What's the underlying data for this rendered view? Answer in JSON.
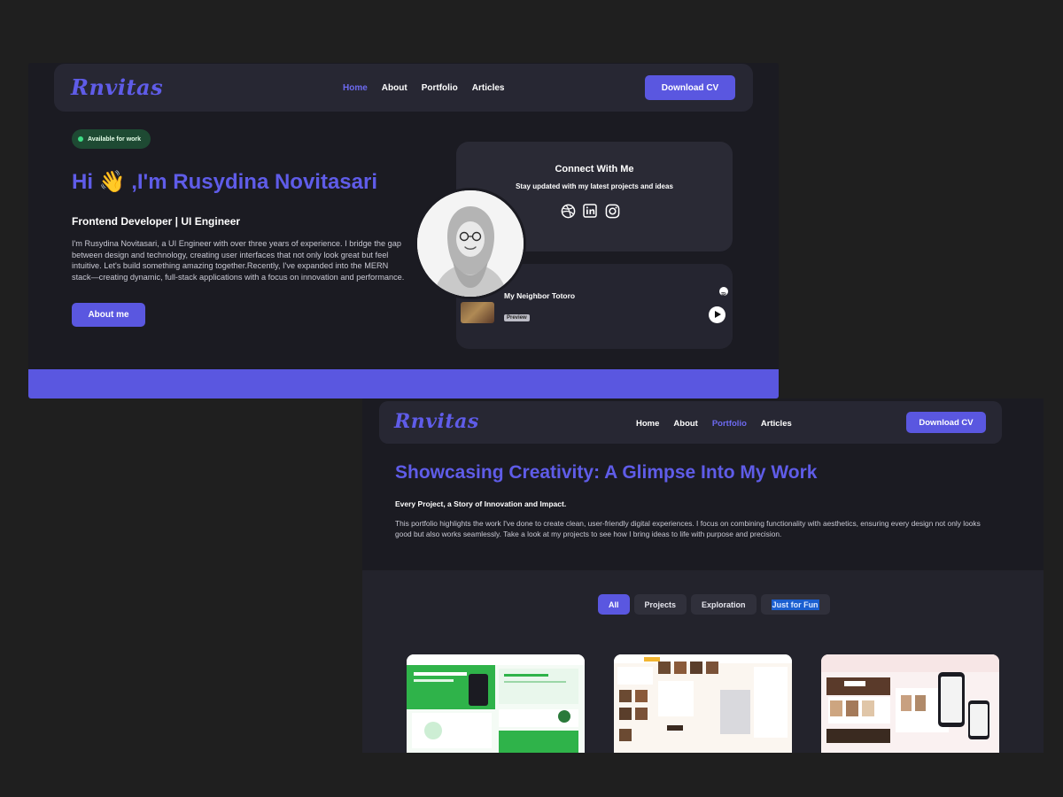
{
  "screen1": {
    "nav": {
      "logo": "Rnvitas",
      "links": [
        "Home",
        "About",
        "Portfolio",
        "Articles"
      ],
      "active": "Home",
      "cta": "Download CV"
    },
    "badge": "Available for work",
    "greeting": "Hi 👋 ,I'm Rusydina Novitasari",
    "role": "Frontend Developer | UI Engineer",
    "bio": "I'm Rusydina Novitasari, a UI Engineer with over three years of experience. I bridge the gap between design and technology, creating user interfaces that not only look great but feel intuitive. Let's build something amazing together.Recently, I've expanded into the MERN stack—creating dynamic, full-stack applications with a focus on innovation and performance.",
    "about_button": "About me",
    "connect": {
      "title": "Connect With Me",
      "subtitle": "Stay updated with my latest projects and ideas",
      "icons": [
        "dribbble-icon",
        "linkedin-icon",
        "instagram-icon"
      ]
    },
    "music": {
      "title": "My Neighbor Totoro",
      "tag": "Preview"
    }
  },
  "screen2": {
    "nav": {
      "logo": "Rnvitas",
      "links": [
        "Home",
        "About",
        "Portfolio",
        "Articles"
      ],
      "active": "Portfolio",
      "cta": "Download CV"
    },
    "heading": "Showcasing Creativity: A Glimpse Into My Work",
    "subheading": "Every Project, a Story of Innovation and Impact.",
    "description": "This portfolio highlights the work I've done to create clean, user-friendly digital experiences. I focus on combining functionality with aesthetics, ensuring every design not only looks good but also works seamlessly. Take a look at my projects to see how I bring ideas to life with purpose and precision.",
    "filters": [
      "All",
      "Projects",
      "Exploration",
      "Just for Fun"
    ],
    "active_filter": "All"
  },
  "colors": {
    "accent": "#5a57e0",
    "heading": "#5f5ce8",
    "background": "#1f1f1f",
    "panel": "#1b1b22",
    "badge_bg": "#1e4a33",
    "badge_dot": "#3ddc84"
  }
}
